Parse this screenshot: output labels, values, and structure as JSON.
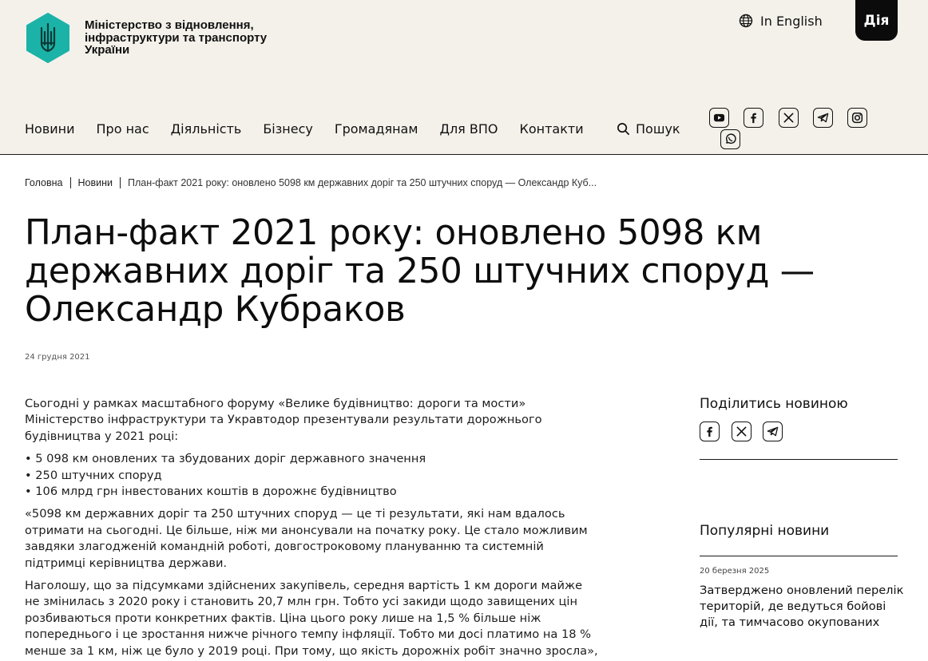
{
  "header": {
    "ministry_name": "Міністерство з відновлення, інфраструктури та транспорту України",
    "language_link": "In English",
    "diia_label": "Дія",
    "nav": [
      "Новини",
      "Про нас",
      "Діяльність",
      "Бізнесу",
      "Громадянам",
      "Для ВПО",
      "Контакти"
    ],
    "search_label": "Пошук",
    "social_icons": [
      "youtube-icon",
      "facebook-icon",
      "x-icon",
      "telegram-icon",
      "instagram-icon",
      "whatsapp-icon"
    ]
  },
  "breadcrumb": {
    "home": "Головна",
    "section": "Новини",
    "current": "План-факт 2021 року: оновлено 5098 км державних доріг та 250 штучних споруд — Олександр Куб..."
  },
  "article": {
    "title": "План-факт 2021 року: оновлено 5098 км державних доріг та 250 штучних споруд — Олександр Кубраков",
    "date": "24 грудня 2021",
    "intro": "Сьогодні у рамках масштабного форуму «Велике будівництво: дороги та мости» Міністерство інфраструктури та Укравтодор презентували результати дорожнього будівництва у 2021 році:",
    "bullets": [
      "5 098 км оновлених та збудованих доріг державного значення",
      "250 штучних споруд",
      "106 млрд грн інвестованих коштів в дорожнє будівництво"
    ],
    "quote": "«5098 км державних доріг та 250 штучних споруд — це ті результати, які нам вдалось отримати на сьогодні. Це більше, ніж ми анонсували на початку року. Це стало можливим завдяки злагодженій командній роботі, довгостроковому плануванню та системній підтримці керівництва держави.",
    "paragraph": "Наголошу, що за підсумками здійснених закупівель, середня вартість 1 км дороги майже не змінилась з 2020 року і становить 20,7 млн грн. Тобто усі закиди щодо завищених цін розбиваються проти конкретних фактів. Ціна цього року лише на 1,5 % більше ніж попереднього і це зростання нижче річного темпу інфляції. Тобто ми досі платимо на 18 % менше за 1 км, ніж це було у 2019 році. При тому, що якість дорожніх робіт значно зросла», — розповів Олександр Кубраков, Міністр інфраструктури України."
  },
  "sidebar": {
    "share_title": "Поділитись новиною",
    "share_icons": [
      "facebook-icon",
      "x-icon",
      "telegram-icon"
    ],
    "popular_title": "Популярні новини",
    "popular": [
      {
        "date": "20 березня 2025",
        "text": "Затверджено оновлений перелік територій, де ведуться бойові дії, та тимчасово окупованих"
      }
    ]
  },
  "colors": {
    "header_bg": "#f4f1ea",
    "logo_teal": "#1bb3a8",
    "text": "#1a1a1a",
    "diia_bg": "#0b0b0b"
  }
}
